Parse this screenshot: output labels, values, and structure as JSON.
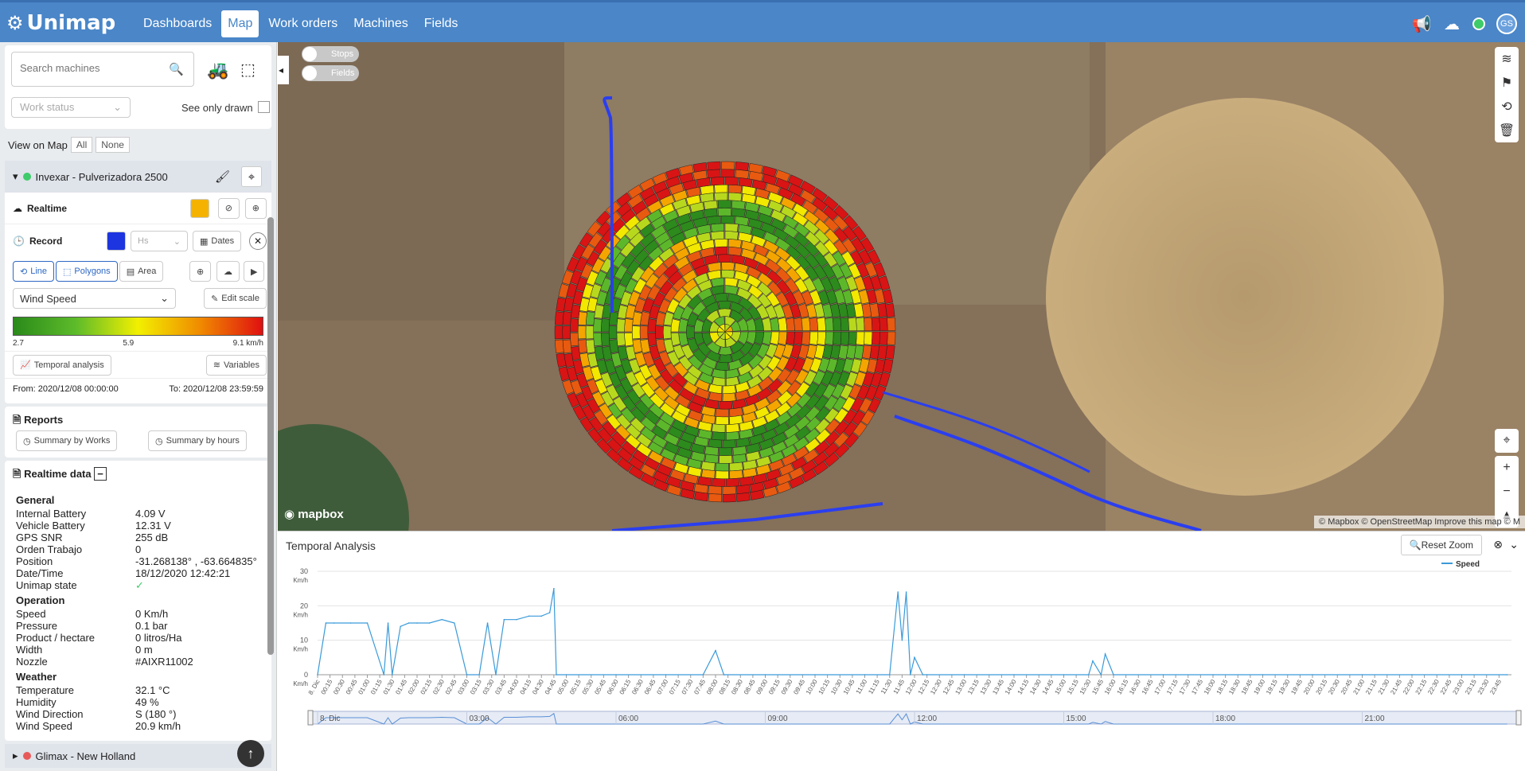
{
  "app": {
    "name": "Unimap"
  },
  "nav": [
    {
      "label": "Dashboards",
      "active": false
    },
    {
      "label": "Map",
      "active": true
    },
    {
      "label": "Work orders",
      "active": false
    },
    {
      "label": "Machines",
      "active": false
    },
    {
      "label": "Fields",
      "active": false
    }
  ],
  "user": {
    "initials": "GS"
  },
  "sidebar": {
    "search_placeholder": "Search machines",
    "work_status": "Work status",
    "see_only_drawn": "See only drawn",
    "view_on_map": "View on Map",
    "all": "All",
    "none": "None",
    "machine1": {
      "name": "Invexar - Pulverizadora 2500",
      "status_color": "#3ecb6a"
    },
    "realtime": {
      "label": "Realtime",
      "color": "#f5b300"
    },
    "record": {
      "label": "Record",
      "color": "#1d35e0",
      "hs": "Hs",
      "dates": "Dates"
    },
    "modes": {
      "line": "Line",
      "polygons": "Polygons",
      "area": "Area"
    },
    "variable": "Wind Speed",
    "edit_scale": "Edit scale",
    "scale": {
      "min": "2.7",
      "mid": "5.9",
      "max": "9.1 km/h"
    },
    "temporal_analysis": "Temporal analysis",
    "variables": "Variables",
    "from": "From: 2020/12/08 00:00:00",
    "to": "To: 2020/12/08 23:59:59",
    "reports": {
      "title": "Reports",
      "by_works": "Summary by Works",
      "by_hours": "Summary by hours"
    },
    "realtime_data": {
      "title": "Realtime data",
      "general_title": "General",
      "general": [
        {
          "k": "Internal Battery",
          "v": "4.09 V"
        },
        {
          "k": "Vehicle Battery",
          "v": "12.31 V"
        },
        {
          "k": "GPS SNR",
          "v": "255 dB"
        },
        {
          "k": "Orden Trabajo",
          "v": "0"
        },
        {
          "k": "Position",
          "v": "-31.268138° , -63.664835°"
        },
        {
          "k": "Date/Time",
          "v": "18/12/2020 12:42:21"
        },
        {
          "k": "Unimap state",
          "v": "✓"
        }
      ],
      "operation_title": "Operation",
      "operation": [
        {
          "k": "Speed",
          "v": "0 Km/h"
        },
        {
          "k": "Pressure",
          "v": "0.1 bar"
        },
        {
          "k": "Product / hectare",
          "v": "0 litros/Ha"
        },
        {
          "k": "Width",
          "v": "0 m"
        },
        {
          "k": "Nozzle",
          "v": "#AIXR11002"
        }
      ],
      "weather_title": "Weather",
      "weather": [
        {
          "k": "Temperature",
          "v": "32.1 °C"
        },
        {
          "k": "Humidity",
          "v": "49 %"
        },
        {
          "k": "Wind Direction",
          "v": "S (180 °)"
        },
        {
          "k": "Wind Speed",
          "v": "20.9 km/h"
        }
      ]
    },
    "machine2": {
      "name": "Glimax - New Holland",
      "status_color": "#e85a5a"
    }
  },
  "map": {
    "toggle_stops": "Stops",
    "toggle_fields": "Fields",
    "attribution": "© Mapbox © OpenStreetMap  Improve this map © M",
    "mapbox_logo": "mapbox"
  },
  "temporal": {
    "title": "Temporal Analysis",
    "reset_zoom": "Reset Zoom",
    "legend": "Speed",
    "y_ticks": [
      "30",
      "20",
      "10",
      "0"
    ],
    "y_unit": "Km/h",
    "navigator_labels": [
      "8. Dic",
      "03:00",
      "06:00",
      "09:00",
      "12:00",
      "15:00",
      "18:00",
      "21:00"
    ]
  },
  "chart_data": {
    "type": "line",
    "title": "Temporal Analysis",
    "ylabel": "Km/h",
    "ylim": [
      0,
      30
    ],
    "x_first_label": "8. Dic",
    "series": [
      {
        "name": "Speed",
        "color": "#3a9ad9",
        "x": [
          "00:00",
          "00:10",
          "00:20",
          "00:40",
          "01:00",
          "01:20",
          "01:25",
          "01:30",
          "01:40",
          "01:50",
          "02:00",
          "02:15",
          "02:30",
          "02:45",
          "03:00",
          "03:15",
          "03:25",
          "03:35",
          "03:45",
          "04:00",
          "04:15",
          "04:30",
          "04:40",
          "04:45",
          "04:48",
          "05:00",
          "06:00",
          "07:00",
          "07:45",
          "08:00",
          "08:10",
          "09:00",
          "10:00",
          "11:00",
          "11:30",
          "11:40",
          "11:45",
          "11:50",
          "11:55",
          "12:00",
          "12:10",
          "12:15",
          "13:00",
          "14:00",
          "15:00",
          "15:30",
          "15:35",
          "15:45",
          "15:50",
          "16:00",
          "17:00",
          "18:00",
          "19:00",
          "20:00",
          "21:00",
          "22:00",
          "23:00",
          "23:55"
        ],
        "y": [
          0,
          15,
          15,
          15,
          15,
          0,
          15,
          0,
          14,
          15,
          15,
          15,
          16,
          15,
          0,
          0,
          15,
          0,
          16,
          16,
          17,
          17,
          18,
          25,
          0,
          0,
          0,
          0,
          0,
          7,
          0,
          0,
          0,
          0,
          0,
          24,
          10,
          24,
          0,
          5,
          0,
          0,
          0,
          0,
          0,
          0,
          4,
          0,
          6,
          0,
          0,
          0,
          0,
          0,
          0,
          0,
          0,
          0
        ]
      }
    ]
  }
}
